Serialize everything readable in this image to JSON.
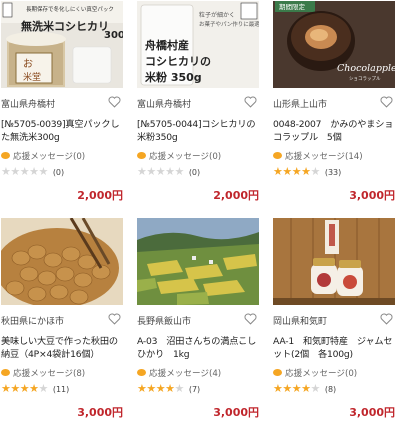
{
  "products": [
    {
      "region": "富山県舟橋村",
      "title": "[№5705-0039]真空パックした無洗米300g",
      "cheer": "応援メッセージ(0)",
      "rating": 0,
      "count": "(0)",
      "price": "2,000円",
      "image_text": {
        "top": "長期保存で冬化しにくい真空パック",
        "main": "無洗米コシヒカリ",
        "weight": "300",
        "seal_top": "お",
        "seal_bottom": "米堂"
      }
    },
    {
      "region": "富山県舟橋村",
      "title": "[№5705-0044]コシヒカリの米粉350g",
      "cheer": "応援メッセージ(0)",
      "rating": 0,
      "count": "(0)",
      "price": "2,000円",
      "image_text": {
        "note1": "粒子が細かく",
        "note2": "お菓子やパン作りに最適",
        "line1": "舟橋村産",
        "line2": "コシヒカリの",
        "line3": "米粉 350g"
      }
    },
    {
      "region": "山形県上山市",
      "title": "0048-2007　かみのやまショコラップル　5個",
      "cheer": "応援メッセージ(14)",
      "rating": 4.5,
      "count": "(33)",
      "price": "3,000円",
      "image_text": {
        "badge": "期間限定",
        "brand": "Chocolapple",
        "brand_kana": "ショコラップル"
      }
    },
    {
      "region": "秋田県にかほ市",
      "title": "美味しい大豆で作った秋田の納豆（4P×4袋計16個）",
      "cheer": "応援メッセージ(8)",
      "rating": 4.5,
      "count": "(11)",
      "price": "3,000円",
      "image_text": {}
    },
    {
      "region": "長野県飯山市",
      "title": "A-03　沼田さんちの満点こしひかり　1kg",
      "cheer": "応援メッセージ(4)",
      "rating": 4.5,
      "count": "(7)",
      "price": "3,000円",
      "image_text": {}
    },
    {
      "region": "岡山県和気町",
      "title": "AA-1　和気町特産　ジャムセット(2個　各100g)",
      "cheer": "応援メッセージ(0)",
      "rating": 4.5,
      "count": "(8)",
      "price": "3,000円",
      "image_text": {}
    }
  ],
  "colors": {
    "price": "#c0262c",
    "star": "#f5a623",
    "star_empty": "#d5d5d5",
    "bubble": "#f5a623"
  },
  "icons": {
    "favorite": "heart-outline-icon",
    "cheer": "speech-bubble-icon"
  }
}
